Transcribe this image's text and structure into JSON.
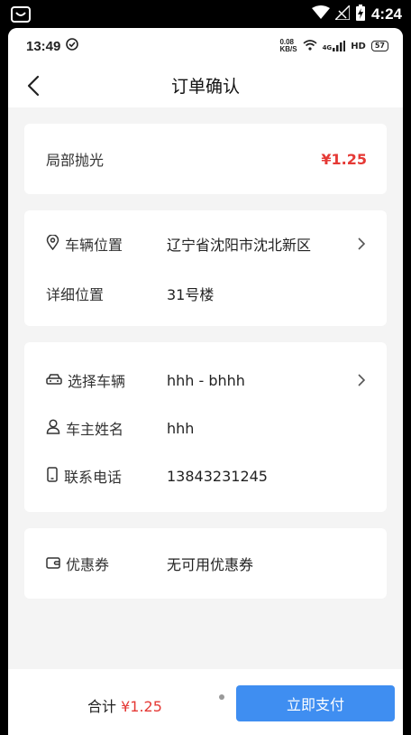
{
  "system_status": {
    "time": "4:24"
  },
  "app_status": {
    "time": "13:49",
    "net_speed_top": "0.08",
    "net_speed_bottom": "KB/S",
    "network": "4G",
    "hd": "HD",
    "battery": "57"
  },
  "header": {
    "title": "订单确认"
  },
  "service": {
    "name": "局部抛光",
    "price": "¥1.25"
  },
  "location": {
    "vehicle_location_label": "车辆位置",
    "vehicle_location_value": "辽宁省沈阳市沈北新区",
    "detail_label": "详细位置",
    "detail_value": "31号楼"
  },
  "vehicle": {
    "select_label": "选择车辆",
    "select_value": "hhh - bhhh",
    "owner_label": "车主姓名",
    "owner_value": "hhh",
    "phone_label": "联系电话",
    "phone_value": "13843231245"
  },
  "coupon": {
    "label": "优惠券",
    "value": "无可用优惠券"
  },
  "footer": {
    "total_label": "合计",
    "total_amount": "¥1.25",
    "pay_label": "立即支付"
  },
  "colors": {
    "accent": "#3f8ef1",
    "price": "#e53935",
    "background": "#f4f4f4"
  },
  "icons": [
    "android-notification-icon",
    "wifi-icon",
    "signal-icon",
    "battery-icon",
    "check-circle-icon",
    "back-icon",
    "location-pin-icon",
    "car-icon",
    "person-icon",
    "phone-icon",
    "coupon-icon",
    "chevron-right-icon"
  ]
}
